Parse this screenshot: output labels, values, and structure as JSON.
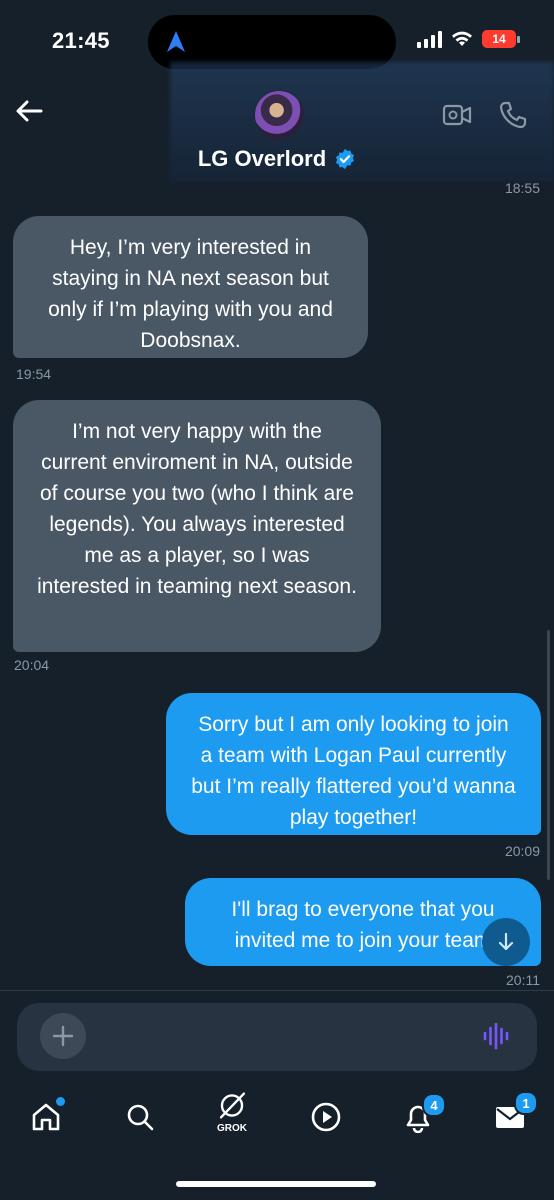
{
  "status_bar": {
    "time": "21:45",
    "battery": "14",
    "icons": [
      "location-arrow-icon",
      "signal-icon",
      "wifi-icon",
      "battery-icon"
    ],
    "battery_color": "#ff3b30"
  },
  "header": {
    "contact_name": "LG Overlord",
    "verified": true,
    "icons": [
      "back-arrow-icon",
      "video-call-icon",
      "phone-call-icon",
      "verified-badge-icon"
    ],
    "previous_timestamp": "18:55"
  },
  "messages": [
    {
      "direction": "incoming",
      "text": "Hey, I’m very interested in staying in NA next season but only if I’m playing with you and Doobsnax.",
      "time": "19:54"
    },
    {
      "direction": "incoming",
      "text": "I’m not very happy with the current enviroment in NA, outside of course you two (who I think are legends). You always interested me as a player, so I was interested in teaming next season.",
      "time": "20:04"
    },
    {
      "direction": "outgoing",
      "text": "Sorry but I am only looking to join a team with Logan Paul currently but I’m really flattered you’d wanna play together!",
      "time": "20:09"
    },
    {
      "direction": "outgoing",
      "text": "I'll brag to everyone that you invited me to join your team",
      "time": "20:11"
    }
  ],
  "composer": {
    "placeholder": "",
    "icons": [
      "plus-icon",
      "voice-wave-icon"
    ]
  },
  "bottom_nav": {
    "items": [
      {
        "name": "home",
        "icon": "home-icon",
        "has_dot": true
      },
      {
        "name": "search",
        "icon": "search-icon"
      },
      {
        "name": "grok",
        "icon": "grok-icon",
        "label": "GROK"
      },
      {
        "name": "video",
        "icon": "play-circle-icon"
      },
      {
        "name": "notifications",
        "icon": "bell-icon",
        "badge": "4"
      },
      {
        "name": "messages",
        "icon": "mail-icon",
        "badge": "1"
      }
    ]
  },
  "colors": {
    "background": "#15202b",
    "incoming_bubble": "#4a5866",
    "outgoing_bubble": "#1d9bf0",
    "accent": "#1d9bf0",
    "muted_text": "#8b98a5"
  }
}
